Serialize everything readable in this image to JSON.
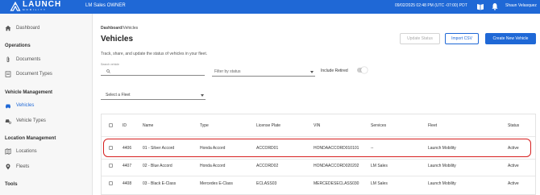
{
  "topbar": {
    "logo_main": "LAUNCH",
    "logo_sub": "MOBILITY",
    "org": "LM Sales OWNER",
    "datetime": "09/02/2025 02:48 PM (UTC -07:00) PDT",
    "user_name": "Shaun Velasquez",
    "colors": {
      "bar": "#1f68d6",
      "text": "#ffffff"
    }
  },
  "sidebar": {
    "dashboard": "Dashboard",
    "operations": {
      "heading": "Operations",
      "items": [
        "Documents",
        "Document Types"
      ]
    },
    "vehicle_management": {
      "heading": "Vehicle Management",
      "items": [
        "Vehicles",
        "Vehicle Types"
      ],
      "active": "Vehicles"
    },
    "location_management": {
      "heading": "Location Management",
      "items": [
        "Locations",
        "Fleets"
      ]
    },
    "tools": {
      "heading": "Tools"
    }
  },
  "main": {
    "breadcrumb": {
      "root": "Dashboard",
      "current": "Vehicles",
      "separator": "/"
    },
    "title": "Vehicles",
    "subtitle": "Track, share, and update the status of vehicles in your fleet.",
    "buttons": {
      "update_status": "Update Status",
      "import_csv": "Import CSV",
      "create_new": "Create New Vehicle"
    },
    "search": {
      "label": "Search vehicle",
      "value": ""
    },
    "filter_status": {
      "placeholder": "Filter by status"
    },
    "include_retired": {
      "label": "Include Retired",
      "checked": false
    },
    "fleet_select": {
      "placeholder": "Select a Fleet"
    }
  },
  "table": {
    "headers": [
      "ID",
      "Name",
      "Type",
      "License Plate",
      "VIN",
      "Services",
      "Fleet",
      "Status"
    ],
    "rows": [
      {
        "id": "4406",
        "name": "01 - Silver Accord",
        "type": "Honda Accord",
        "plate": "ACCORD01",
        "vin": "HONDAACCORD010101",
        "services": "--",
        "fleet": "Launch Mobility",
        "status": "Active",
        "highlighted": true
      },
      {
        "id": "4407",
        "name": "02 - Blue Accord",
        "type": "Honda Accord",
        "plate": "ACCORD02",
        "vin": "HONDAACCORD020202",
        "services": "LM Sales",
        "fleet": "Launch Mobility",
        "status": "Active",
        "highlighted": false
      },
      {
        "id": "4408",
        "name": "03 - Black E-Class",
        "type": "Mercedes E-Class",
        "plate": "ECLASS03",
        "vin": "MERCEDESECLASS030",
        "services": "LM Sales",
        "fleet": "Launch Mobility",
        "status": "Active",
        "highlighted": false
      }
    ],
    "highlight_color": "#d61f1f"
  }
}
